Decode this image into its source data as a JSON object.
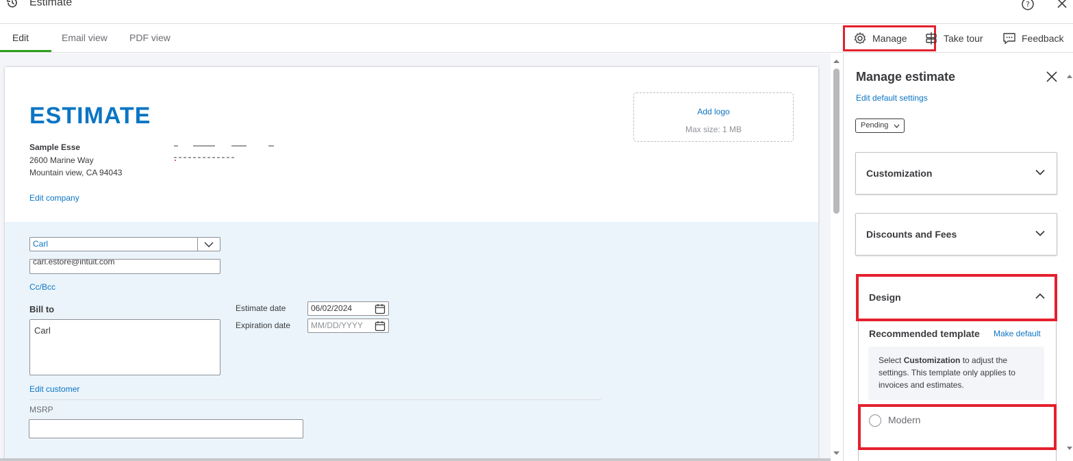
{
  "window": {
    "title": "Estimate"
  },
  "tabs": [
    {
      "label": "Edit",
      "active": true
    },
    {
      "label": "Email view",
      "active": false
    },
    {
      "label": "PDF view",
      "active": false
    }
  ],
  "actions": {
    "manage": "Manage",
    "tour": "Take tour",
    "feedback": "Feedback"
  },
  "estimate": {
    "title": "ESTIMATE",
    "company_name": "Sample Esse",
    "address_line1": "2600 Marine Way",
    "address_line2": "Mountain view, CA 94043",
    "edit_company": "Edit company",
    "add_logo": "Add logo",
    "max_size": "Max size: 1 MB"
  },
  "customer": {
    "name": "Carl",
    "email": "carl.estore@intuit.com",
    "cc_bcc": "Cc/Bcc",
    "bill_to_label": "Bill to",
    "bill_to_value": "Carl",
    "edit_customer": "Edit customer",
    "msrp_label": "MSRP",
    "estimate_date_label": "Estimate date",
    "estimate_date_value": "06/02/2024",
    "expiration_date_label": "Expiration date",
    "expiration_date_placeholder": "MM/DD/YYYY"
  },
  "panel": {
    "title": "Manage estimate",
    "edit_defaults": "Edit default settings",
    "status": "Pending",
    "sections": {
      "customization": "Customization",
      "discounts": "Discounts and Fees",
      "design": "Design"
    },
    "recommended_template": "Recommended template",
    "make_default": "Make default",
    "info_pre": "Select ",
    "info_bold": "Customization",
    "info_post": " to adjust the settings. This template only applies to invoices and estimates.",
    "template_option": "Modern"
  },
  "colors": {
    "accent": "#0b75c4",
    "highlight": "#e4202e",
    "active_tab": "#2ca01c"
  }
}
